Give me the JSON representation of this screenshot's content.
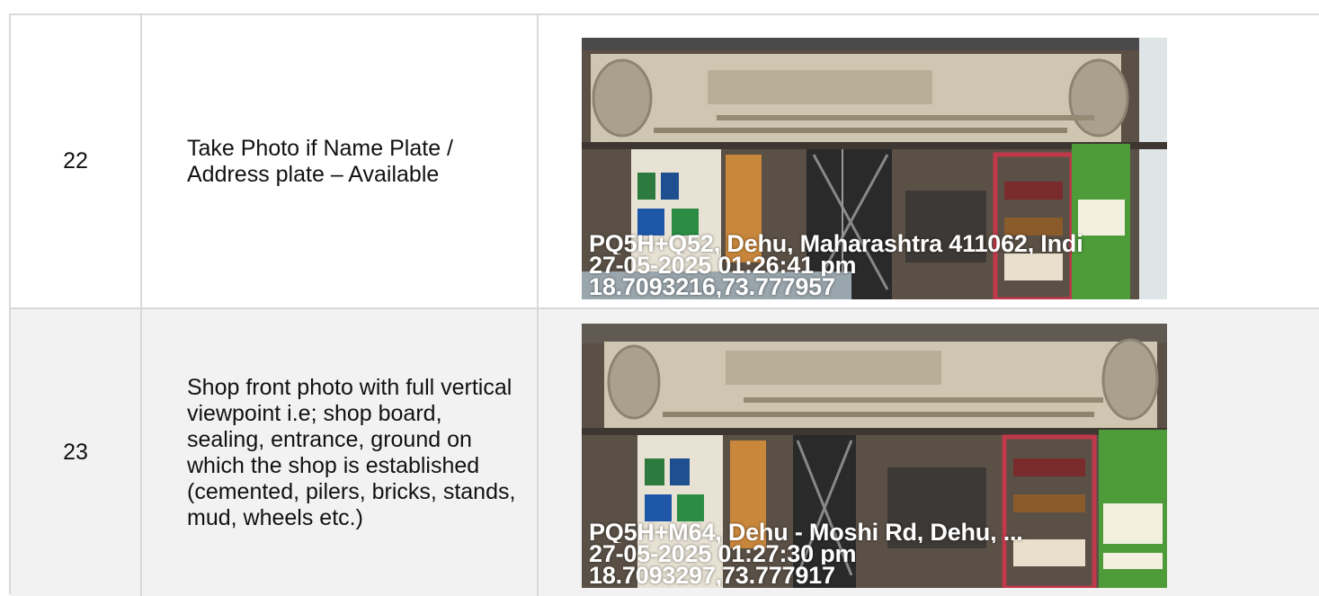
{
  "rows": [
    {
      "number": "22",
      "description": "Take Photo if Name Plate / Address plate – Available",
      "photo": {
        "address": "PQ5H+Q52, Dehu, Maharashtra 411062, Indi",
        "datetime": "27-05-2025 01:26:41 pm",
        "coords": "18.7093216,73.777957"
      }
    },
    {
      "number": "23",
      "description": "Shop front photo with full vertical viewpoint i.e; shop board, sealing, entrance, ground on which the shop is established (cemented, pilers, bricks, stands, mud, wheels etc.)",
      "photo": {
        "address": "PQ5H+M64, Dehu - Moshi Rd, Dehu, ...",
        "datetime": "27-05-2025 01:27:30 pm",
        "coords": "18.7093297,73.777917"
      }
    }
  ],
  "colors": {
    "grid": "#d9d9d9",
    "row_alt": "#f2f2f2",
    "board": "#cfc6b2",
    "shelf": "#c0394a"
  }
}
